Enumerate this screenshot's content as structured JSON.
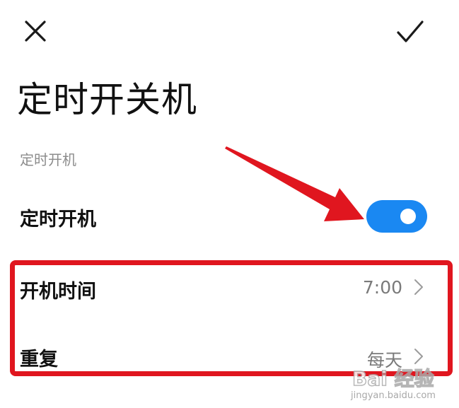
{
  "header": {
    "close_icon": "close-icon",
    "confirm_icon": "checkmark-icon",
    "title": "定时开关机"
  },
  "section": {
    "title": "定时开机"
  },
  "rows": [
    {
      "label": "定时开机",
      "control": "toggle",
      "toggle_on": true
    },
    {
      "label": "开机时间",
      "value": "7:00",
      "icon": "chevron-right-icon"
    },
    {
      "label": "重复",
      "value": "每天",
      "icon": "chevron-right-icon"
    }
  ],
  "colors": {
    "toggle_on": "#1a88f2",
    "annotation_red": "#e0161f",
    "secondary_text": "#7a7a7a"
  },
  "watermark": {
    "logo": "Bai 经验",
    "url": "jingyan.baidu.com"
  }
}
